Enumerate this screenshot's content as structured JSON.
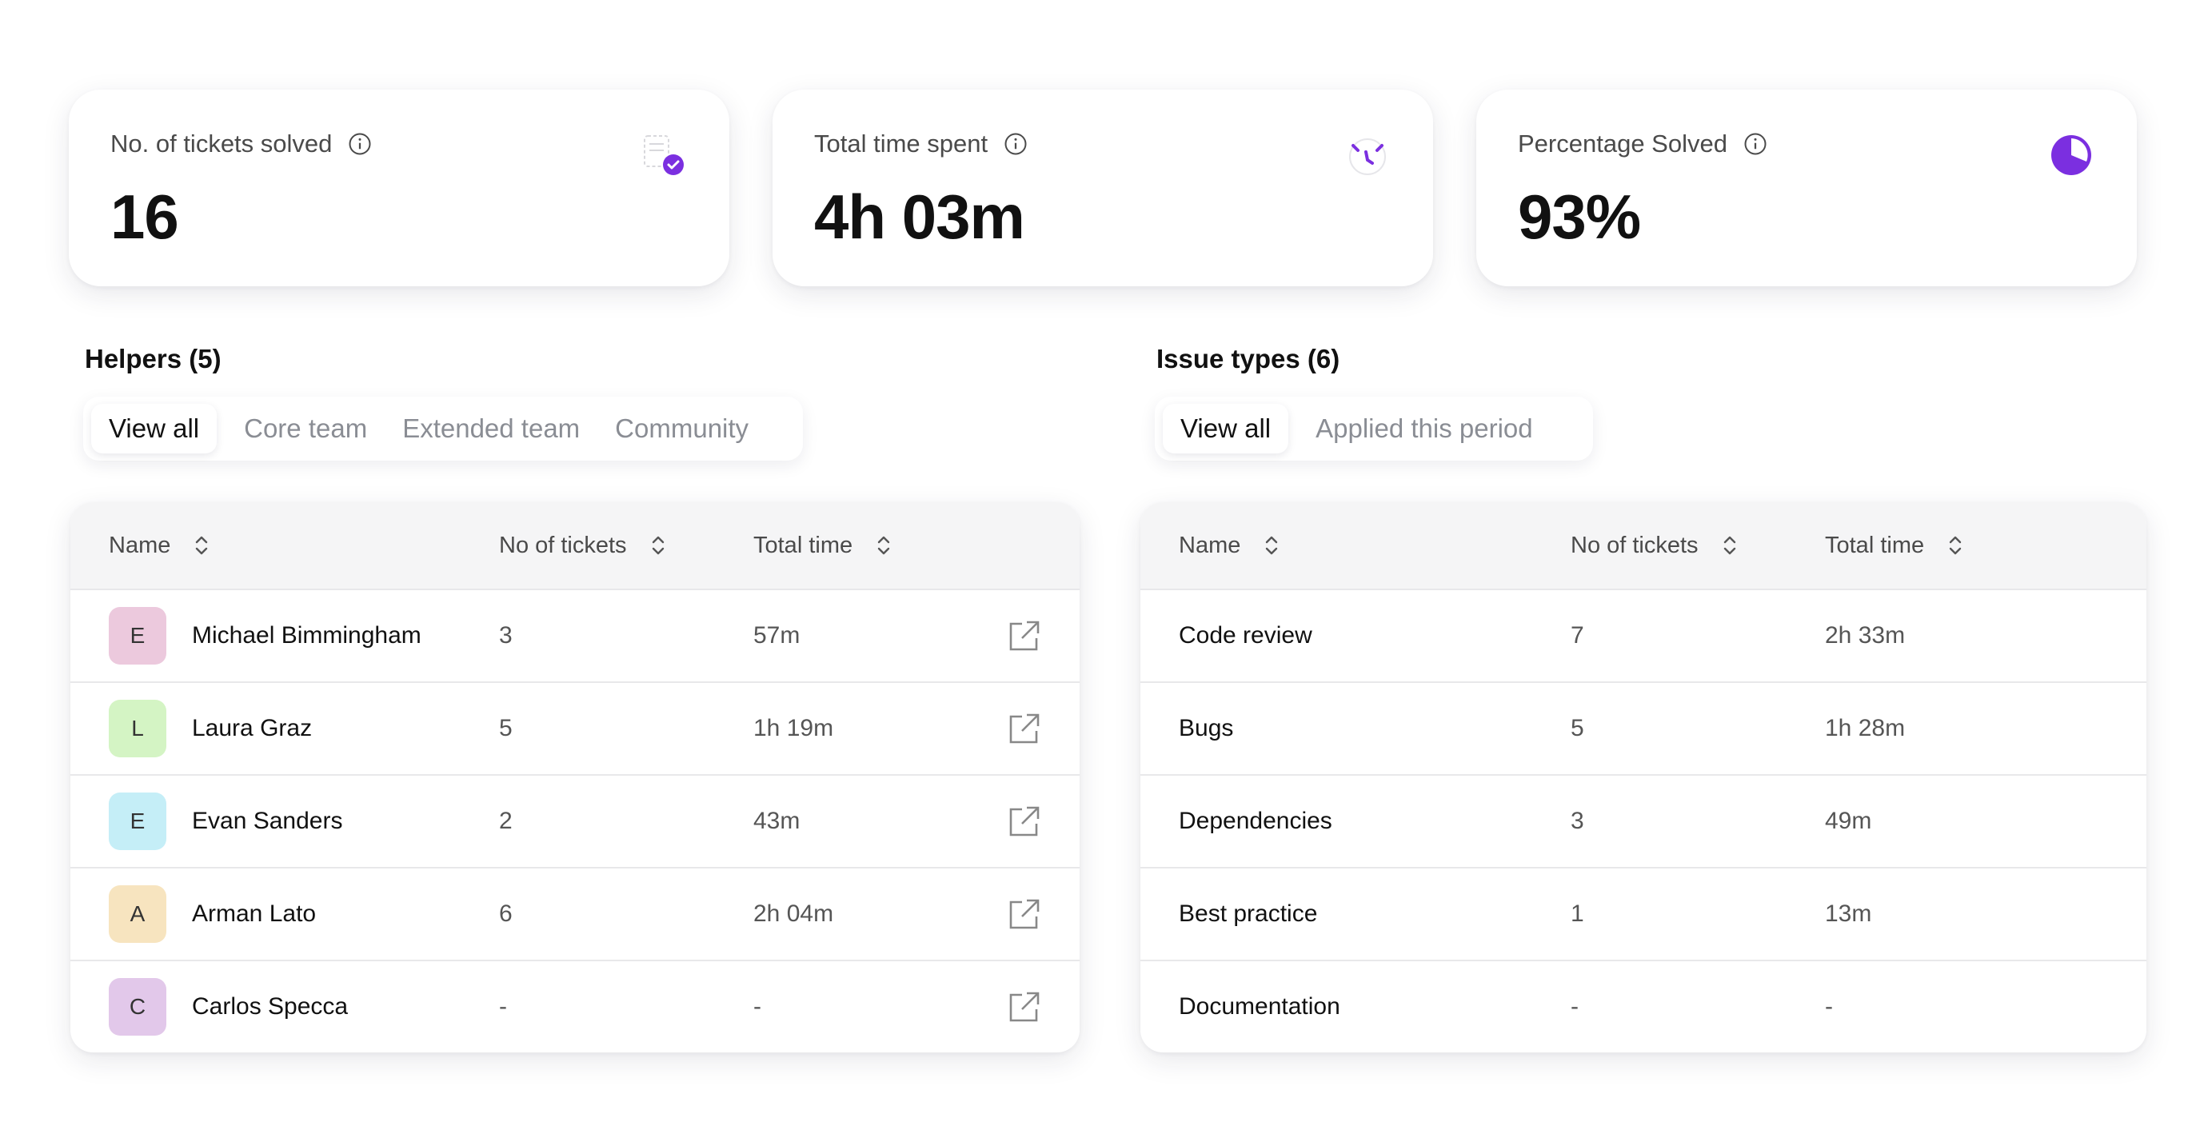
{
  "stats": [
    {
      "label": "No. of tickets solved",
      "value": "16",
      "icon": "ticket-check-icon"
    },
    {
      "label": "Total time spent",
      "value": "4h 03m",
      "icon": "timer-icon"
    },
    {
      "label": "Percentage Solved",
      "value": "93%",
      "icon": "pie-chart-icon"
    }
  ],
  "accent_color": "#7b2fe0",
  "helpers": {
    "title": "Helpers (5)",
    "tabs": [
      "View all",
      "Core team",
      "Extended team",
      "Community"
    ],
    "active_tab": "View all",
    "columns": [
      "Name",
      "No of tickets",
      "Total time"
    ],
    "rows": [
      {
        "initial": "E",
        "name": "Michael Bimmingham",
        "tickets": "3",
        "time": "57m",
        "avatar_color": "#ecc9dd"
      },
      {
        "initial": "L",
        "name": "Laura Graz",
        "tickets": "5",
        "time": "1h 19m",
        "avatar_color": "#d4f4c4"
      },
      {
        "initial": "E",
        "name": "Evan Sanders",
        "tickets": "2",
        "time": "43m",
        "avatar_color": "#c5eef7"
      },
      {
        "initial": "A",
        "name": "Arman Lato",
        "tickets": "6",
        "time": "2h 04m",
        "avatar_color": "#f7e4bf"
      },
      {
        "initial": "C",
        "name": "Carlos Specca",
        "tickets": "-",
        "time": "-",
        "avatar_color": "#e2c8ea"
      }
    ]
  },
  "issues": {
    "title": "Issue types (6)",
    "tabs": [
      "View all",
      "Applied this period"
    ],
    "active_tab": "View all",
    "columns": [
      "Name",
      "No of tickets",
      "Total time"
    ],
    "rows": [
      {
        "name": "Code review",
        "tickets": "7",
        "time": "2h 33m"
      },
      {
        "name": "Bugs",
        "tickets": "5",
        "time": "1h 28m"
      },
      {
        "name": "Dependencies",
        "tickets": "3",
        "time": "49m"
      },
      {
        "name": "Best practice",
        "tickets": "1",
        "time": "13m"
      },
      {
        "name": "Documentation",
        "tickets": "-",
        "time": "-"
      }
    ]
  }
}
